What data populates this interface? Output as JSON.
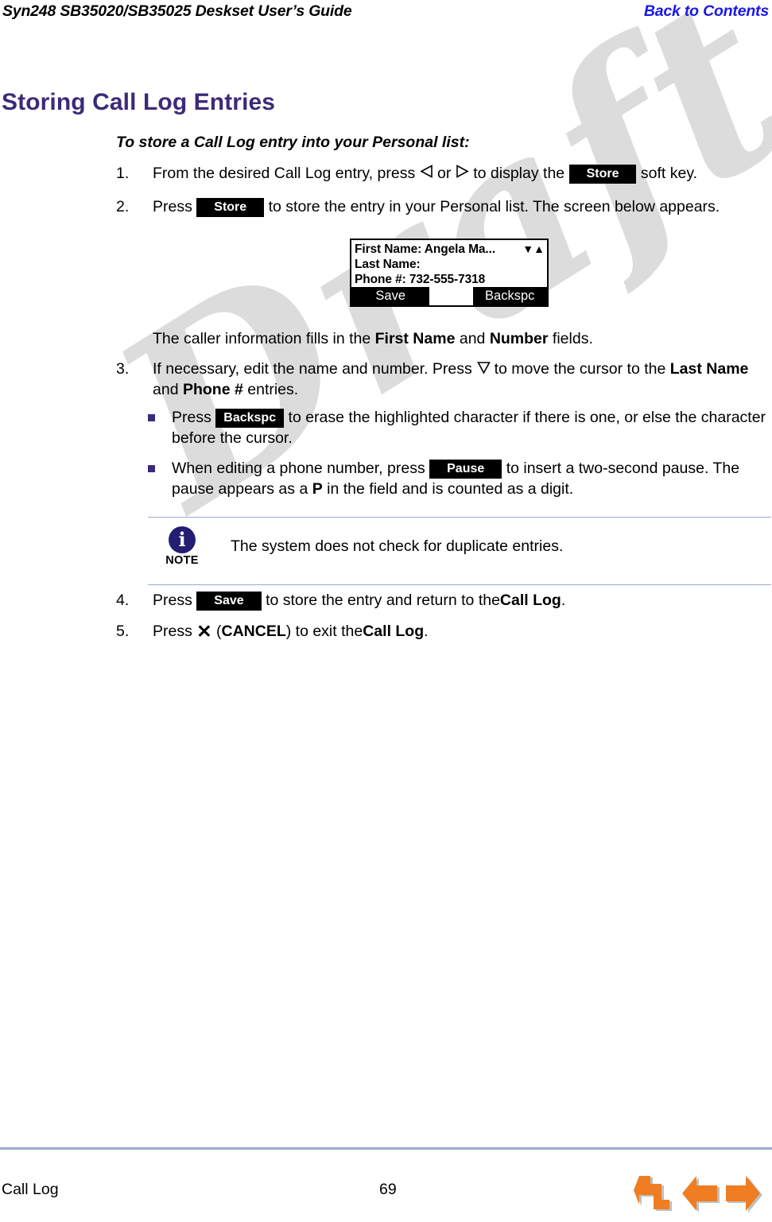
{
  "header": {
    "title": "Syn248 SB35020/SB35025 Deskset User’s Guide",
    "back_link": "Back to Contents"
  },
  "page_title": "Storing Call Log Entries",
  "watermark": "Draft",
  "section": {
    "subhead": "To store a Call Log entry into your Personal list:",
    "step1": {
      "number": "1.",
      "part_a": "From the desired Call Log entry, press",
      "or": "or",
      "part_b": "to display the",
      "key": "Store",
      "part_c": "soft key."
    },
    "step2": {
      "number": "2.",
      "part_a": "Press",
      "key": "Store",
      "part_b": "to store the entry in your Personal list. The screen below appears."
    },
    "caption": {
      "part_a": "The caller information fills in the",
      "bold_a": "First Name",
      "and": "and",
      "bold_b": "Number",
      "part_b": "fields."
    },
    "step3": {
      "number": "3.",
      "part_a": "If necessary, edit the name and number. Press",
      "part_b": "to move the cursor to the",
      "bold_a": "Last Name",
      "and": "and",
      "bold_b": "Phone #",
      "part_c": "entries."
    },
    "bullet1": {
      "part_a": "Press",
      "key": "Backspc",
      "part_b": "to erase the highlighted character if there is one, or else the character before the cursor."
    },
    "bullet2": {
      "part_a": "When editing a phone number, press",
      "key": "Pause",
      "part_b": "to insert a two-second pause. The pause appears as a",
      "bold_p": "P",
      "part_c": "in the field and is counted as a digit."
    },
    "step4": {
      "number": "4.",
      "part_a": "Press",
      "key": "Save",
      "part_b": "to store the entry and return to the",
      "bold_a": "Call Log",
      "period": "."
    },
    "step5": {
      "number": "5.",
      "part_a": "Press",
      "x_glyph": "✕",
      "open_paren": "(",
      "bold_cancel": "CANCEL",
      "close_paren": ")",
      "part_b": "to exit the",
      "bold_a": "Call Log",
      "period": "."
    }
  },
  "lcd": {
    "line1": "First Name: Angela Ma...",
    "line2": "Last Name:",
    "line3": "Phone #: 732-555-7318",
    "scroll_glyphs": "▼▲",
    "soft_left": "Save",
    "soft_mid": "",
    "soft_right": "Backspc"
  },
  "note": {
    "label": "NOTE",
    "text": "The system does not check for duplicate entries."
  },
  "footer": {
    "section": "Call Log",
    "page_number": "69",
    "nav": {
      "back": "back-arrow",
      "previous": "previous-page-arrow",
      "next": "next-page-arrow"
    }
  },
  "colors": {
    "title_purple": "#3b2a7a",
    "link_blue": "#1a18e8",
    "rule_blue": "#9aabce",
    "note_navy": "#241e72",
    "nav_orange": "#f07d22"
  }
}
